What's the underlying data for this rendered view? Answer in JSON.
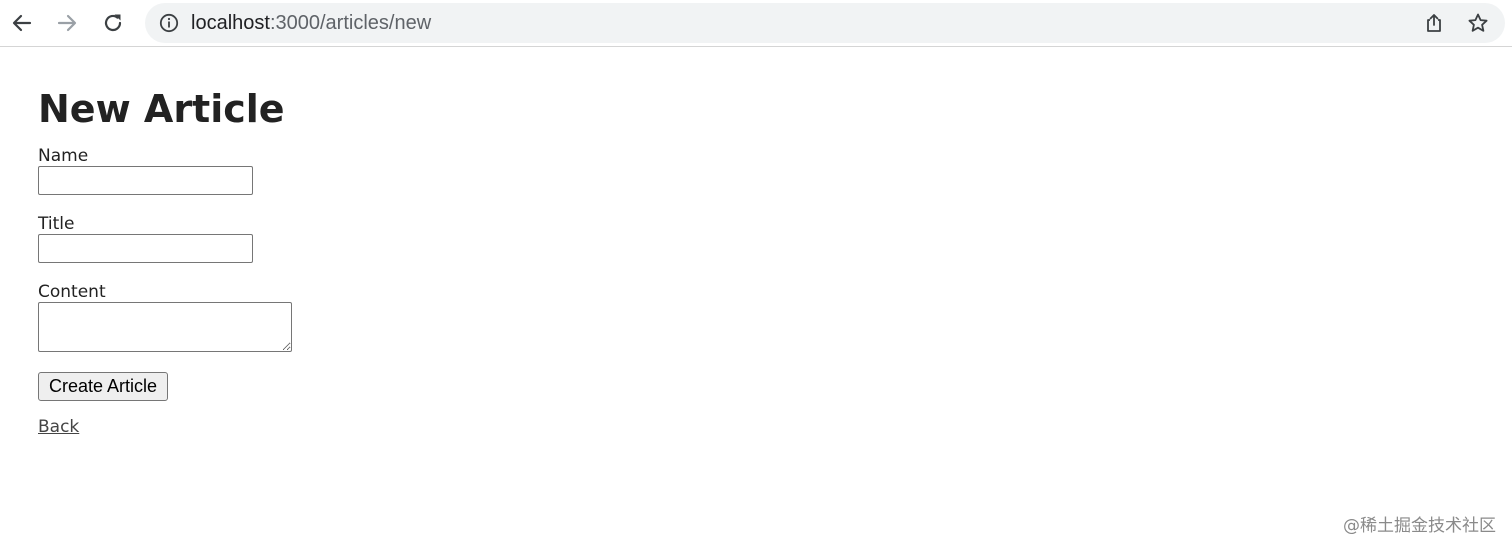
{
  "browser": {
    "url_host": "localhost",
    "url_path": ":3000/articles/new",
    "icons": {
      "back": "arrow-left-icon",
      "forward": "arrow-right-icon",
      "reload": "reload-icon",
      "info": "info-icon",
      "share": "share-icon",
      "bookmark": "star-icon"
    }
  },
  "page": {
    "title": "New Article",
    "fields": {
      "name": {
        "label": "Name",
        "value": ""
      },
      "title": {
        "label": "Title",
        "value": ""
      },
      "content": {
        "label": "Content",
        "value": ""
      }
    },
    "submit_label": "Create Article",
    "back_link": "Back"
  },
  "watermark": "@稀土掘金技术社区",
  "colors": {
    "text": "#222222",
    "link": "#444444",
    "address_bar_bg": "#f1f3f4",
    "button_bg": "#efefef"
  }
}
